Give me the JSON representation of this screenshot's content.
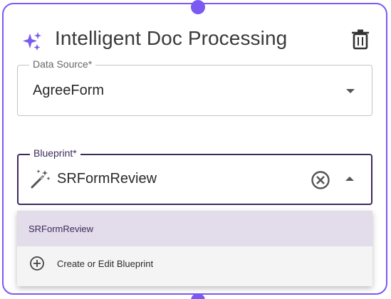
{
  "header": {
    "title": "Intelligent Doc Processing",
    "icon": "sparkle-icon",
    "delete_icon": "trash-icon"
  },
  "data_source": {
    "label": "Data Source*",
    "value": "AgreeForm"
  },
  "blueprint": {
    "label": "Blueprint*",
    "value": "SRFormReview",
    "icon": "wand-icon"
  },
  "dropdown": {
    "options": [
      {
        "label": "SRFormReview",
        "selected": true
      },
      {
        "label": "Create or Edit Blueprint",
        "icon": "plus-circle-icon"
      }
    ]
  },
  "colors": {
    "accent": "#7a5af0",
    "focus_border": "#3d2a5c",
    "selected_bg": "#e3dcea"
  }
}
